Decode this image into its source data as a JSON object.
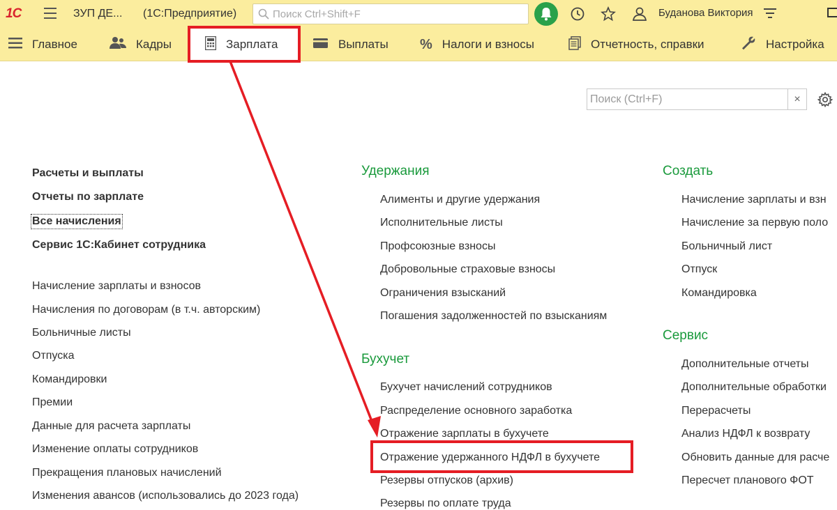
{
  "topbar": {
    "logo": "1С",
    "app_title": "ЗУП ДЕ...",
    "app_subtitle": "(1С:Предприятие)",
    "search_placeholder": "Поиск Ctrl+Shift+F",
    "user_name": "Буданова Виктория"
  },
  "sections": [
    {
      "label": "Главное",
      "icon": "menu-lines-icon"
    },
    {
      "label": "Кадры",
      "icon": "people-icon"
    },
    {
      "label": "Зарплата",
      "icon": "calculator-icon"
    },
    {
      "label": "Выплаты",
      "icon": "wallet-icon"
    },
    {
      "label": "Налоги и взносы",
      "icon": "percent-icon"
    },
    {
      "label": "Отчетность, справки",
      "icon": "documents-icon"
    },
    {
      "label": "Настройка",
      "icon": "wrench-icon"
    }
  ],
  "content_search": {
    "placeholder": "Поиск (Ctrl+F)",
    "clear": "×"
  },
  "left_column": {
    "bold_links": [
      "Расчеты и выплаты",
      "Отчеты по зарплате",
      "Все начисления",
      "Сервис 1С:Кабинет сотрудника"
    ],
    "links": [
      "Начисление зарплаты и взносов",
      "Начисления по договорам (в т.ч. авторским)",
      "Больничные листы",
      "Отпуска",
      "Командировки",
      "Премии",
      "Данные для расчета зарплаты",
      "Изменение оплаты сотрудников",
      "Прекращения плановых начислений",
      "Изменения авансов (использовались до 2023 года)"
    ]
  },
  "middle_column": {
    "groups": [
      {
        "title": "Удержания",
        "items": [
          "Алименты и другие удержания",
          "Исполнительные листы",
          "Профсоюзные взносы",
          "Добровольные страховые взносы",
          "Ограничения взысканий",
          "Погашения задолженностей по взысканиям"
        ]
      },
      {
        "title": "Бухучет",
        "items": [
          "Бухучет начислений сотрудников",
          "Распределение основного заработка",
          "Отражение зарплаты в бухучете",
          "Отражение удержанного НДФЛ в бухучете",
          "Резервы отпусков (архив)",
          "Резервы по оплате труда"
        ]
      }
    ]
  },
  "right_column": {
    "groups": [
      {
        "title": "Создать",
        "items": [
          "Начисление зарплаты и взн",
          "Начисление за первую поло",
          "Больничный лист",
          "Отпуск",
          "Командировка"
        ]
      },
      {
        "title": "Сервис",
        "items": [
          "Дополнительные отчеты",
          "Дополнительные обработки",
          "Перерасчеты",
          "Анализ НДФЛ к возврату",
          "Обновить данные для расче",
          "Пересчет планового ФОТ"
        ]
      }
    ]
  },
  "colors": {
    "panel": "#fbed9e",
    "highlight": "#e51d24",
    "group_title": "#1a9a3c",
    "bell": "#2aa14a"
  }
}
